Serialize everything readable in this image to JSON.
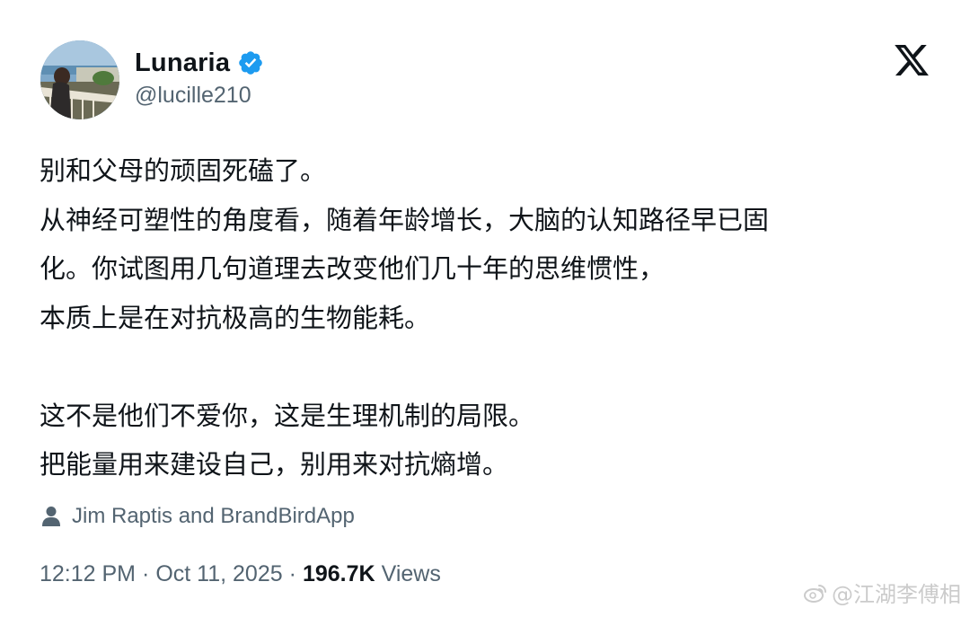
{
  "author": {
    "display_name": "Lunaria",
    "handle": "@lucille210",
    "verified": true
  },
  "tweet": {
    "lines": [
      "别和父母的顽固死磕了。",
      "从神经可塑性的角度看，随着年龄增长，大脑的认知路径早已固",
      "化。你试图用几句道理去改变他们几十年的思维惯性，",
      "本质上是在对抗极高的生物能耗。",
      "",
      "这不是他们不爱你，这是生理机制的局限。",
      "把能量用来建设自己，别用来对抗熵增。"
    ]
  },
  "context": {
    "icon": "person-icon",
    "text": "Jim Raptis and BrandBirdApp"
  },
  "meta": {
    "time": "12:12 PM",
    "separator": "·",
    "date": "Oct 11, 2025",
    "views_count": "196.7K",
    "views_label": "Views"
  },
  "watermark": {
    "icon": "weibo-icon",
    "text": "@江湖李傅相"
  },
  "colors": {
    "text_primary": "#0f1419",
    "text_secondary": "#536471",
    "verified_blue": "#1d9bf0",
    "watermark": "#c9c9c9"
  },
  "icons": {
    "brand": "x-logo-icon",
    "verified": "verified-badge-icon"
  }
}
